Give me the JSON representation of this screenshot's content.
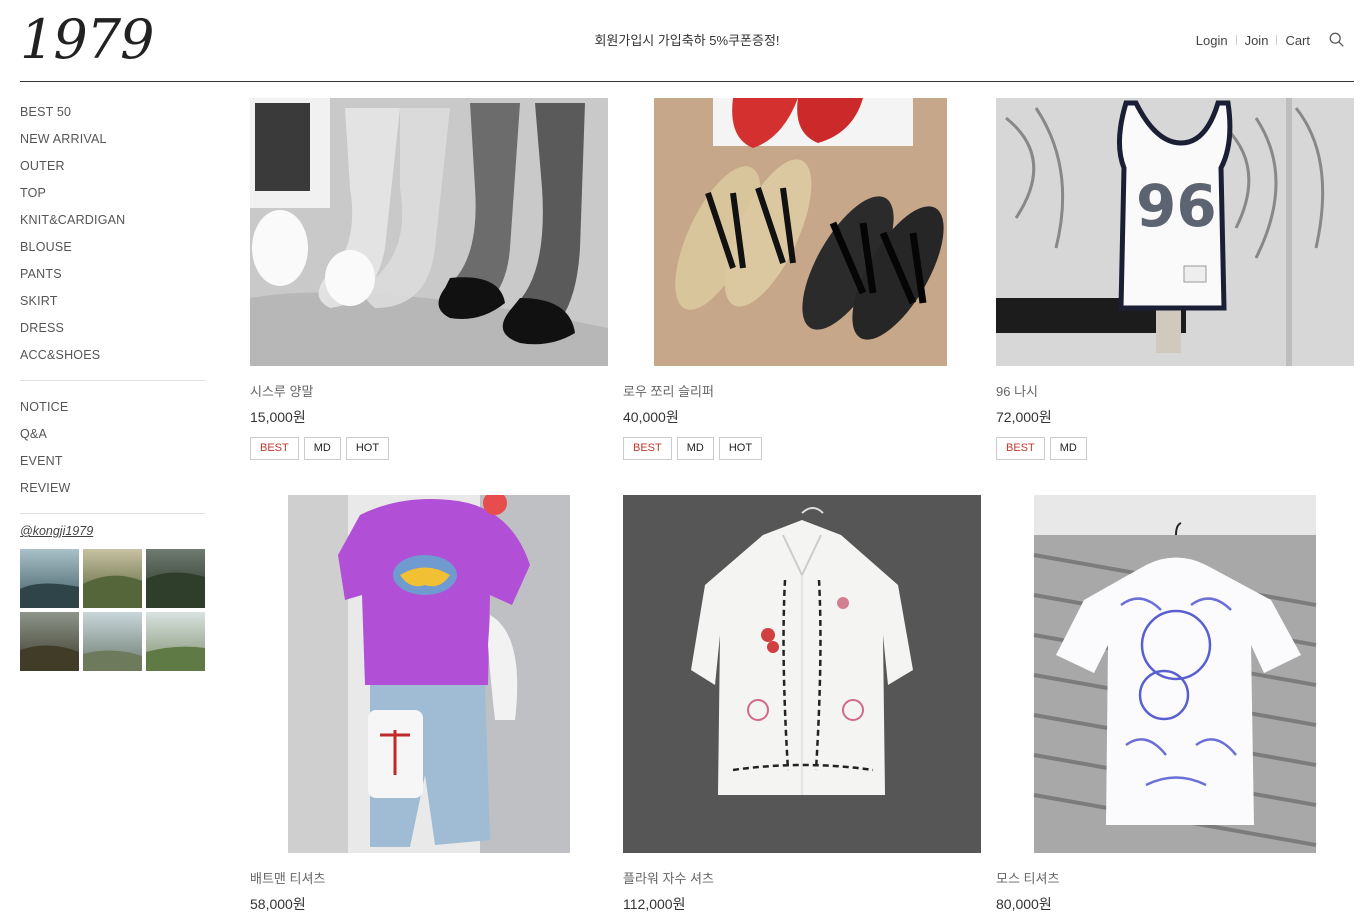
{
  "header": {
    "logo": "1979",
    "promo": "회원가입시 가입축하 5%쿠폰증정!",
    "nav": [
      "Login",
      "Join",
      "Cart"
    ],
    "search_icon": "search-icon"
  },
  "sidebar": {
    "categories": [
      "BEST 50",
      "NEW ARRIVAL",
      "OUTER",
      "TOP",
      "KNIT&CARDIGAN",
      "BLOUSE",
      "PANTS",
      "SKIRT",
      "DRESS",
      "ACC&SHOES"
    ],
    "boards": [
      "NOTICE",
      "Q&A",
      "EVENT",
      "REVIEW"
    ],
    "instagram": "@kongji1979"
  },
  "products": [
    {
      "name": "시스루 양말",
      "price": "15,000원",
      "badges": [
        "BEST",
        "MD",
        "HOT"
      ]
    },
    {
      "name": "로우 쪼리 슬리퍼",
      "price": "40,000원",
      "badges": [
        "BEST",
        "MD",
        "HOT"
      ]
    },
    {
      "name": "96 나시",
      "price": "72,000원",
      "badges": [
        "BEST",
        "MD"
      ]
    },
    {
      "name": "배트맨 티셔츠",
      "price": "58,000원",
      "badges": []
    },
    {
      "name": "플라워 자수 셔츠",
      "price": "112,000원",
      "badges": []
    },
    {
      "name": "모스 티셔츠",
      "price": "80,000원",
      "badges": []
    }
  ],
  "colors": {
    "best_badge": "#c0392b",
    "header_rule": "#333333"
  }
}
